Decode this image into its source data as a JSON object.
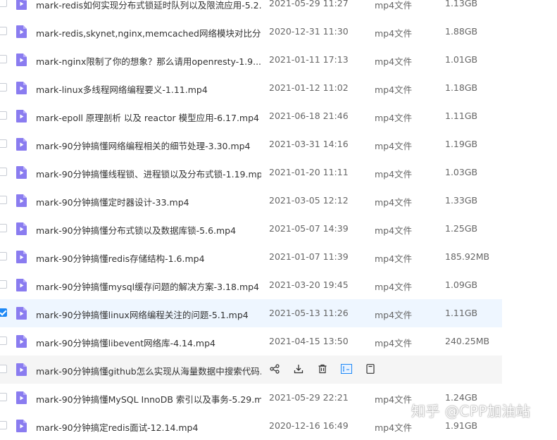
{
  "files": [
    {
      "name": "mark-redis如何实现分布式锁延时队列以及限流应用-5.2...",
      "date": "2021-05-29 11:27",
      "type": "mp4文件",
      "size": "1.13GB"
    },
    {
      "name": "mark-redis,skynet,nginx,memcached网络模块对比分...",
      "date": "2020-12-31 11:30",
      "type": "mp4文件",
      "size": "1.88GB"
    },
    {
      "name": "mark-nginx限制了你的想象？那么请用openresty-1.9....",
      "date": "2021-01-11 17:13",
      "type": "mp4文件",
      "size": "1.01GB"
    },
    {
      "name": "mark-linux多线程网络编程要义-1.11.mp4",
      "date": "2021-01-12 11:02",
      "type": "mp4文件",
      "size": "1.18GB"
    },
    {
      "name": "mark-epoll 原理剖析 以及 reactor 模型应用-6.17.mp4",
      "date": "2021-06-18 21:46",
      "type": "mp4文件",
      "size": "1.11GB"
    },
    {
      "name": "mark-90分钟搞懂网络编程相关的细节处理-3.30.mp4",
      "date": "2021-03-31 14:16",
      "type": "mp4文件",
      "size": "1.19GB"
    },
    {
      "name": "mark-90分钟搞懂线程锁、进程锁以及分布式锁-1.19.mp4",
      "date": "2021-01-20 11:11",
      "type": "mp4文件",
      "size": "1.03GB"
    },
    {
      "name": "mark-90分钟搞懂定时器设计-33.mp4",
      "date": "2021-03-05 12:12",
      "type": "mp4文件",
      "size": "1.33GB"
    },
    {
      "name": "mark-90分钟搞懂分布式锁以及数据库锁-5.6.mp4",
      "date": "2021-05-07 14:39",
      "type": "mp4文件",
      "size": "1.25GB"
    },
    {
      "name": "mark-90分钟搞懂redis存储结构-1.6.mp4",
      "date": "2021-01-07 11:39",
      "type": "mp4文件",
      "size": "185.92MB"
    },
    {
      "name": "mark-90分钟搞懂mysql缓存问题的解决方案-3.18.mp4",
      "date": "2021-03-20 19:45",
      "type": "mp4文件",
      "size": "1.09GB"
    },
    {
      "name": "mark-90分钟搞懂linux网络编程关注的问题-5.1.mp4",
      "date": "2021-05-13 11:26",
      "type": "mp4文件",
      "size": "1.11GB"
    },
    {
      "name": "mark-90分钟搞懂libevent网络库-4.14.mp4",
      "date": "2021-04-15 13:50",
      "type": "mp4文件",
      "size": "240.25MB"
    },
    {
      "name": "mark-90分钟搞懂github怎么实现从海量数据中搜索代码...",
      "date": "",
      "type": "",
      "size": ""
    },
    {
      "name": "mark-90分钟搞懂MySQL InnoDB 索引以及事务-5.29.m...",
      "date": "2021-05-29 22:21",
      "type": "mp4文件",
      "size": "1.24GB"
    },
    {
      "name": "mark-90分钟搞定redis面试-12.14.mp4",
      "date": "2020-12-16 16:49",
      "type": "mp4文件",
      "size": "1.91GB"
    }
  ],
  "selected_index": 11,
  "hovered_index": 13,
  "hover_actions": [
    "share-icon",
    "download-icon",
    "delete-icon",
    "rename-icon",
    "more-icon"
  ],
  "colors": {
    "accent": "#1e88f5",
    "file_icon": "#8a7cf0",
    "selected_bg": "#eef6ff"
  },
  "watermark": "知乎 @CPP加油站"
}
